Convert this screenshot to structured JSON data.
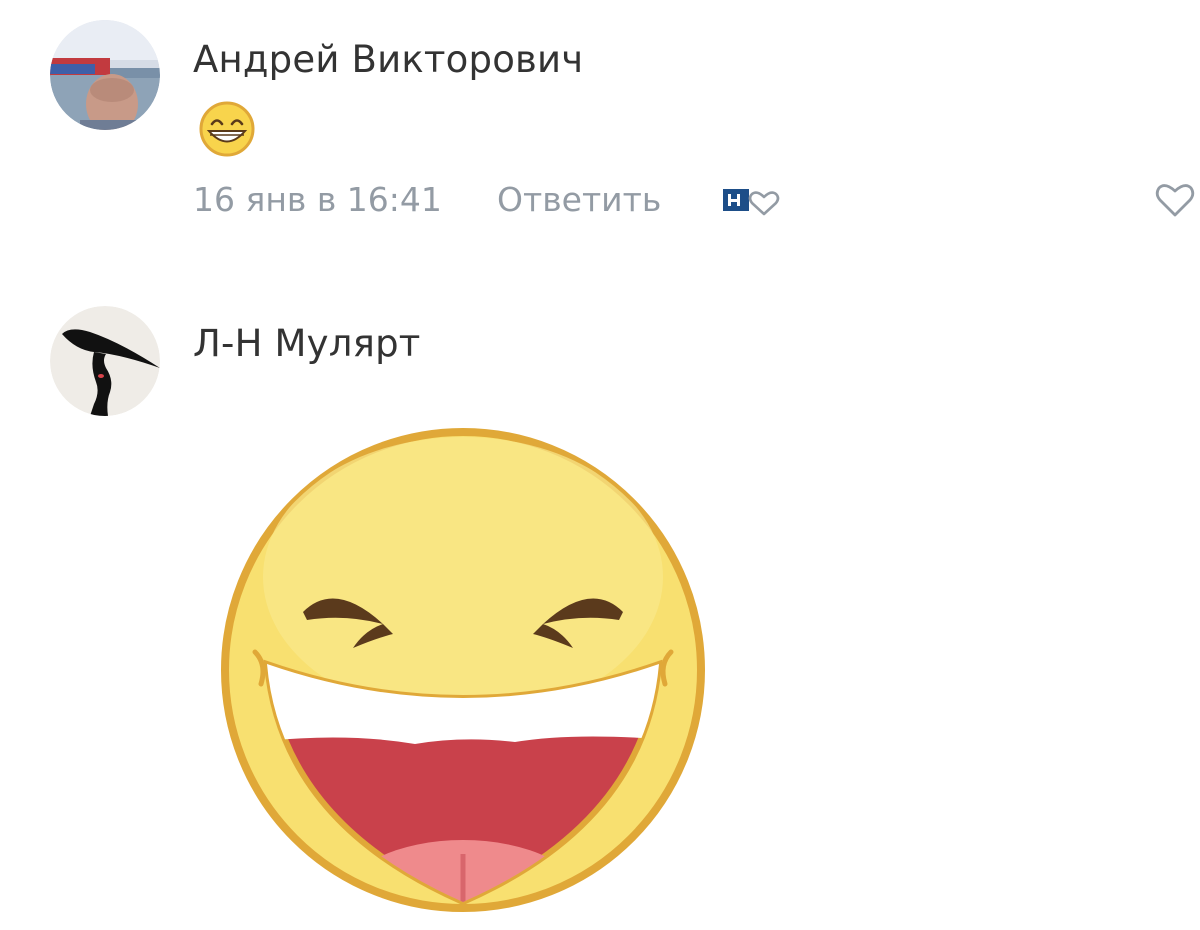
{
  "comments": [
    {
      "author": "Андрей Викторович",
      "text_emoji": "grinning-face-emoji",
      "timestamp": "16 янв в 16:41",
      "reply_label": "Ответить",
      "badge_icon": "nh-heart-icon",
      "like_icon": "heart-outline-icon"
    },
    {
      "author": "Л-Н Мулярт",
      "sticker": "laughing-smiley-sticker"
    }
  ],
  "colors": {
    "text_primary": "#333333",
    "text_secondary": "#939ba4",
    "smiley_yellow": "#f8e070",
    "smiley_outline": "#e0a838",
    "mouth_red": "#c9414b",
    "tongue_pink": "#ef8a8c",
    "badge_blue": "#1d4e88"
  }
}
